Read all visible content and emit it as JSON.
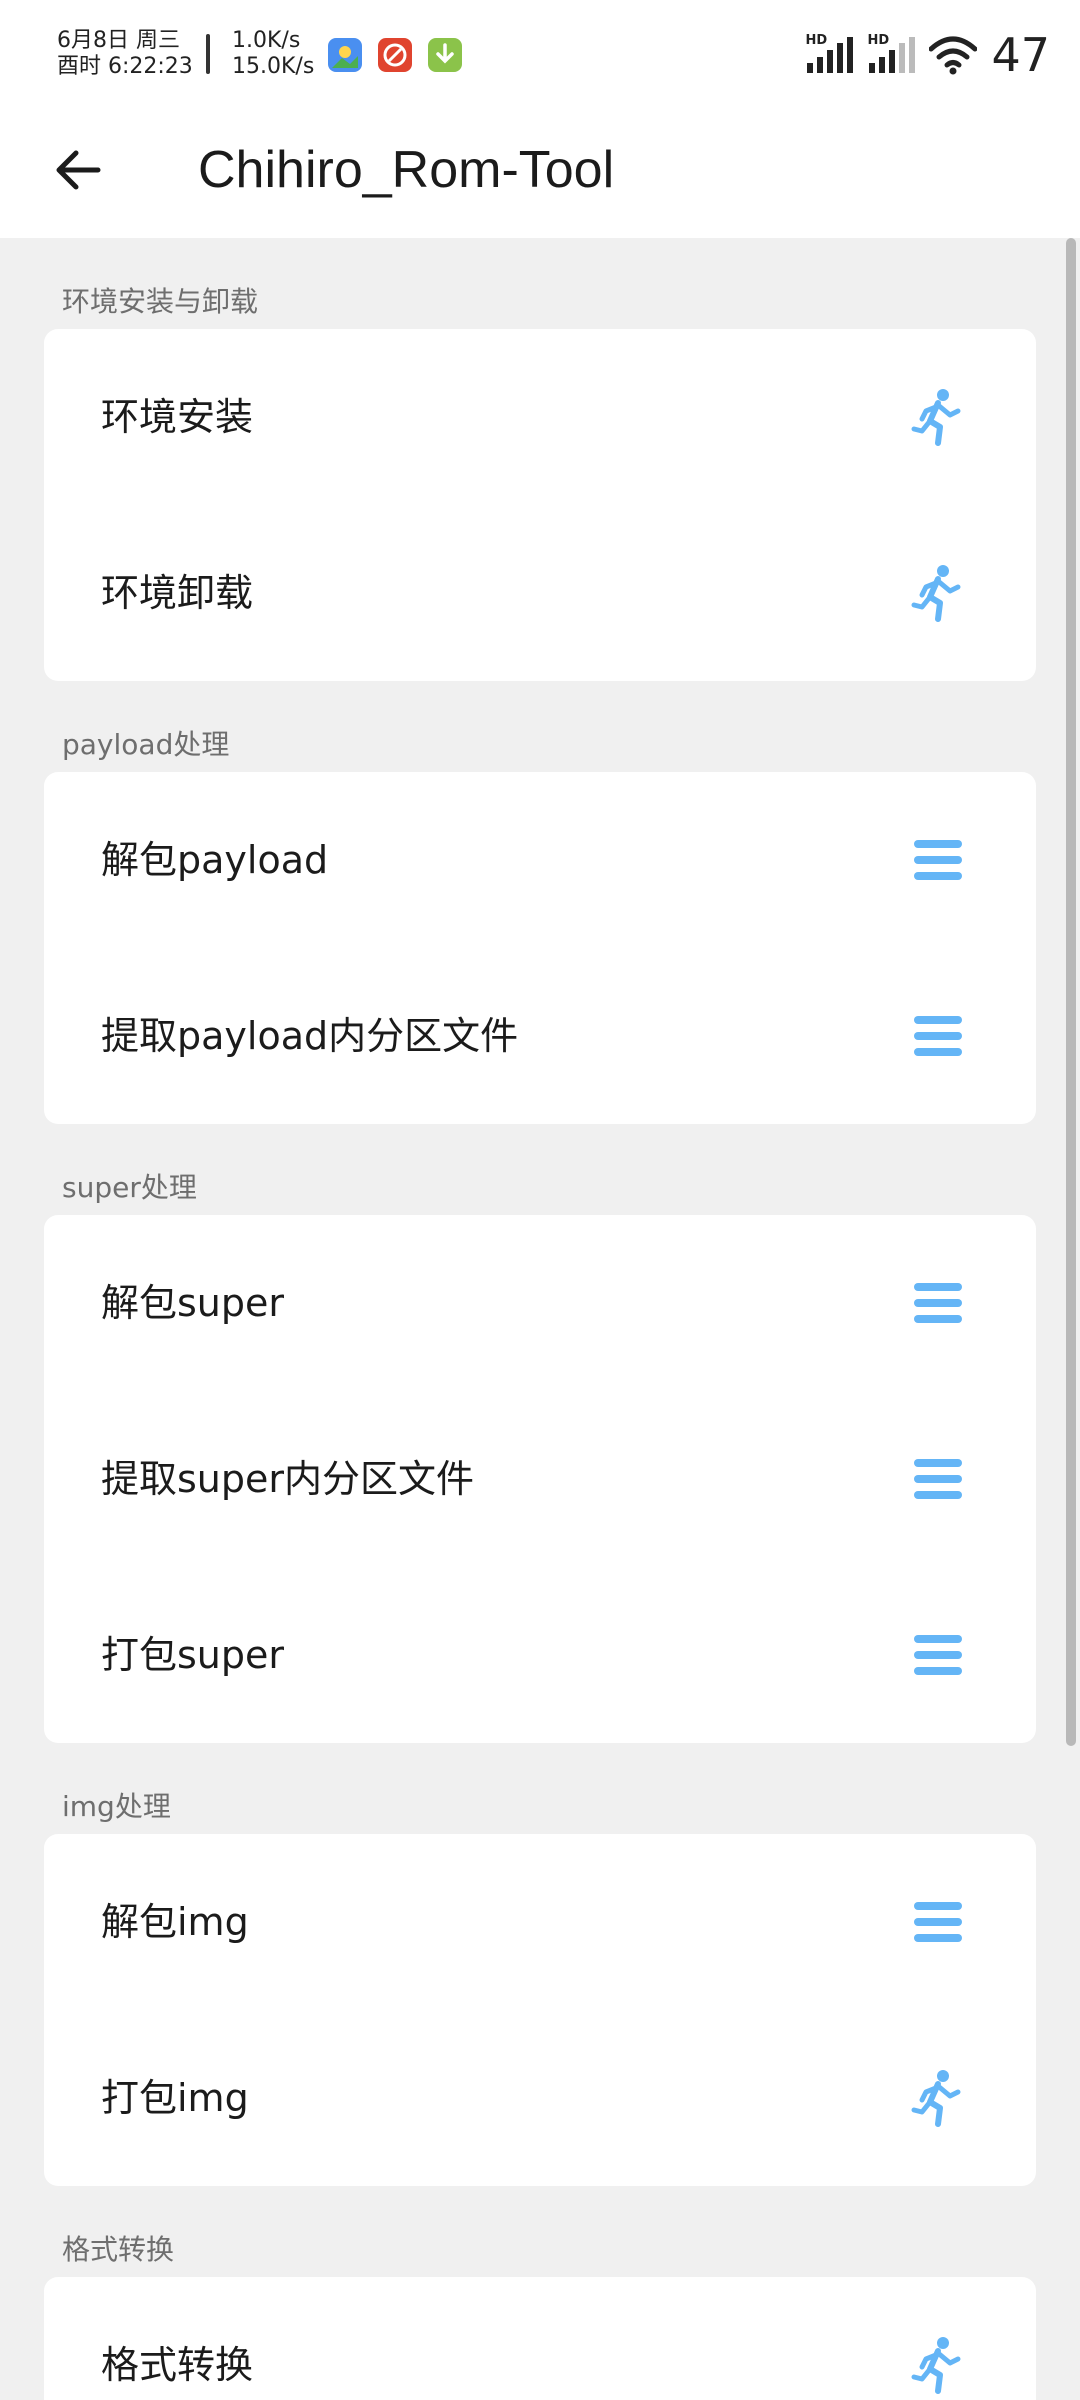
{
  "status_bar": {
    "date": "6月8日 周三",
    "time": "酉时 6:22:23",
    "speed_up": "1.0K/s",
    "speed_down": "15.0K/s",
    "signal_1": "HD",
    "signal_2": "HD",
    "battery": "47"
  },
  "app_bar": {
    "title": "Chihiro_Rom-Tool"
  },
  "sections": [
    {
      "header": "环境安装与卸载",
      "items": [
        {
          "label": "环境安装",
          "icon": "run-icon"
        },
        {
          "label": "环境卸载",
          "icon": "run-icon"
        }
      ]
    },
    {
      "header": "payload处理",
      "items": [
        {
          "label": "解包payload",
          "icon": "menu-icon"
        },
        {
          "label": "提取payload内分区文件",
          "icon": "menu-icon"
        }
      ]
    },
    {
      "header": "super处理",
      "items": [
        {
          "label": "解包super",
          "icon": "menu-icon"
        },
        {
          "label": "提取super内分区文件",
          "icon": "menu-icon"
        },
        {
          "label": "打包super",
          "icon": "menu-icon"
        }
      ]
    },
    {
      "header": "img处理",
      "items": [
        {
          "label": "解包img",
          "icon": "menu-icon"
        },
        {
          "label": "打包img",
          "icon": "run-icon"
        }
      ]
    },
    {
      "header": "格式转换",
      "items": [
        {
          "label": "格式转换",
          "icon": "run-icon"
        }
      ]
    }
  ],
  "colors": {
    "accent": "#64b5f6",
    "background": "#f0f0f0",
    "card": "#ffffff"
  }
}
